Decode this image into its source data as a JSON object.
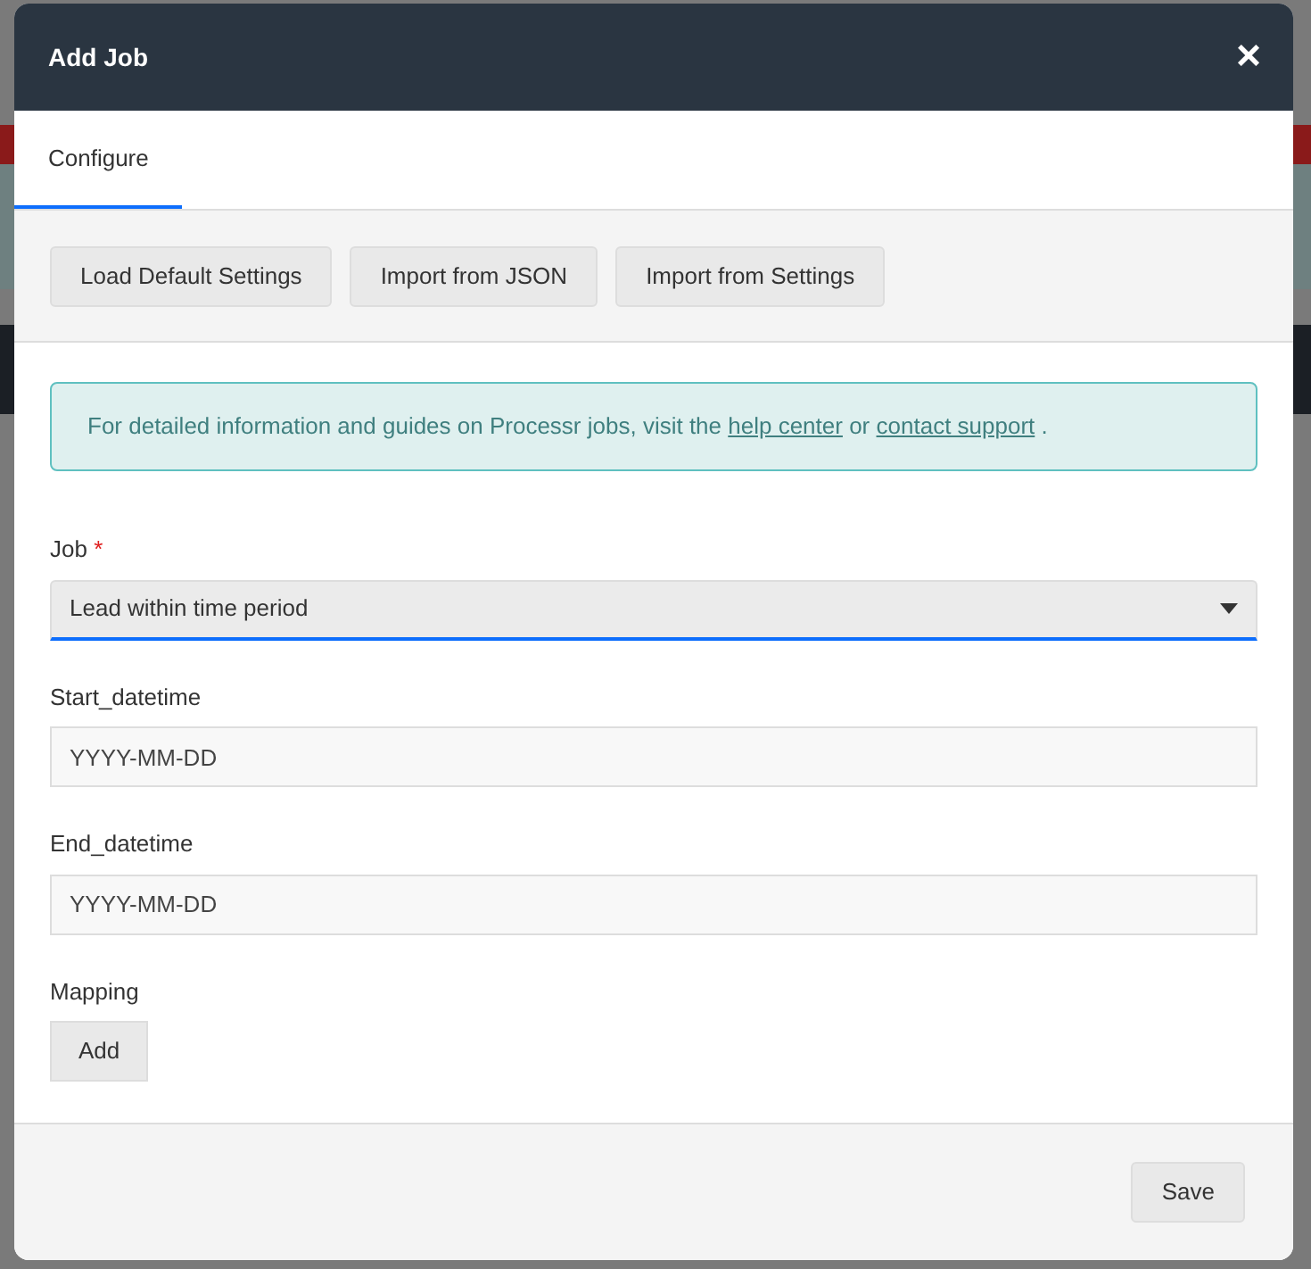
{
  "modal": {
    "title": "Add Job",
    "close": "×"
  },
  "tabs": [
    {
      "label": "Configure",
      "selected": true
    }
  ],
  "toolbar": [
    "Load Default Settings",
    "Import from JSON",
    "Import from Settings"
  ],
  "info": {
    "text": "For detailed information and guides on Processr jobs, visit the",
    "link1": "help center",
    "middle": "or",
    "link2": "contact support",
    "end": "."
  },
  "fields": [
    {
      "kind": "select",
      "label": "Job",
      "required_mark": "*",
      "value": "Lead within time period",
      "focused": true
    },
    {
      "kind": "text",
      "label": "Start_datetime",
      "placeholder": "YYYY-MM-DD",
      "focused": false
    },
    {
      "kind": "text",
      "label": "End_datetime",
      "placeholder": "YYYY-MM-DD",
      "focused": false
    },
    {
      "kind": "button",
      "label": "Mapping",
      "button": "Add",
      "focused": false
    }
  ],
  "footer": {
    "save": "Save"
  }
}
